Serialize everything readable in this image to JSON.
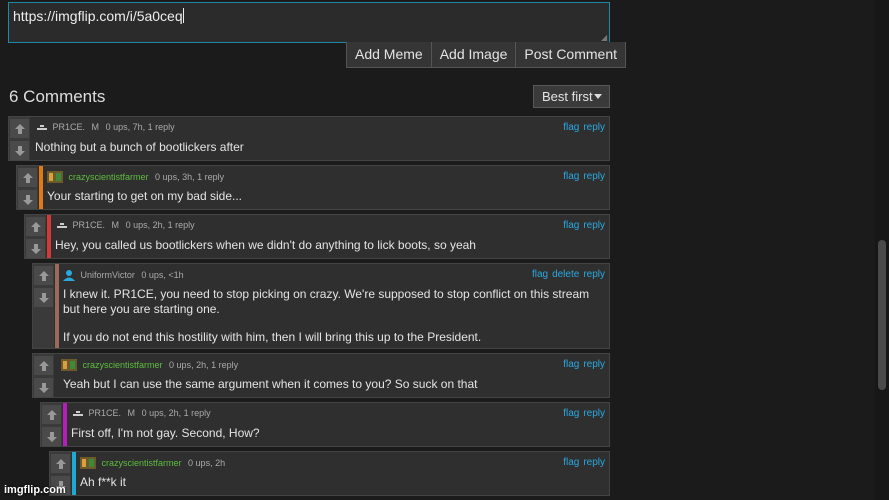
{
  "input": {
    "value": "https://imgflip.com/i/5a0ceq"
  },
  "buttons": {
    "add_meme": "Add Meme",
    "add_image": "Add Image",
    "post_comment": "Post Comment"
  },
  "count": "6 Comments",
  "sort": {
    "selected": "Best first"
  },
  "comments": [
    {
      "user": "PR1CE.",
      "badge": "M",
      "meta": "0 ups, 7h, 1 reply",
      "text": "Nothing but a bunch of bootlickers after",
      "links": [
        "flag",
        "reply"
      ]
    },
    {
      "user": "crazyscientistfarmer",
      "badge": "",
      "meta": "0 ups, 3h, 1 reply",
      "text": "Your starting to get on my bad side...",
      "links": [
        "flag",
        "reply"
      ]
    },
    {
      "user": "PR1CE.",
      "badge": "M",
      "meta": "0 ups, 2h, 1 reply",
      "text": "Hey, you called us bootlickers when we didn't do anything to lick boots, so yeah",
      "links": [
        "flag",
        "reply"
      ]
    },
    {
      "user": "UniformVictor",
      "badge": "",
      "meta": "0 ups, <1h",
      "text": "I knew it. PR1CE, you need to stop picking on crazy. We're supposed to stop conflict on this stream but here you are starting one.",
      "text2": "If you do not end this hostility with him, then I will bring this up to the President.",
      "links": [
        "flag",
        "delete",
        "reply"
      ]
    },
    {
      "user": "crazyscientistfarmer",
      "badge": "",
      "meta": "0 ups, 2h, 1 reply",
      "text": "Yeah but I can use the same argument when it comes to you? So suck on that",
      "links": [
        "flag",
        "reply"
      ]
    },
    {
      "user": "PR1CE.",
      "badge": "M",
      "meta": "0 ups, 2h, 1 reply",
      "text": "First off, I'm not gay. Second, How?",
      "links": [
        "flag",
        "reply"
      ]
    },
    {
      "user": "crazyscientistfarmer",
      "badge": "",
      "meta": "0 ups, 2h",
      "text": "Ah f**k it",
      "links": [
        "flag",
        "reply"
      ]
    }
  ],
  "watermark": "imgflip.com",
  "colors": {
    "orange": "#e07b12",
    "red": "#d23a3a",
    "brown": "#9b6a5b",
    "purple": "#b31fb8",
    "cyan": "#1da8d6"
  }
}
